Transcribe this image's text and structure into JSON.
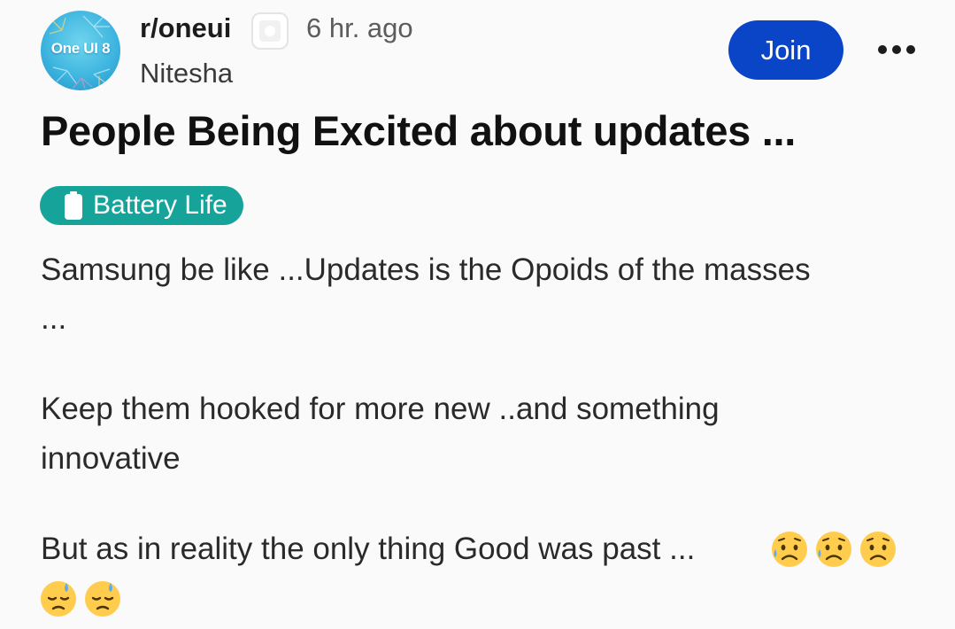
{
  "post": {
    "avatar": {
      "label": "One UI 8",
      "bg_color": "#3fb6e0"
    },
    "subreddit": "r/oneui",
    "badge_icon": "achievement-badge-icon",
    "timestamp": "6 hr. ago",
    "author": "Nitesha",
    "join_label": "Join",
    "more_icon": "more-options-icon",
    "title": "People Being Excited about updates ...",
    "flair": {
      "icon": "battery-icon",
      "label": "Battery Life",
      "color": "#16a39a"
    },
    "body": {
      "line1": "Samsung be like ...Updates is the Opoids of the masses",
      "line2": "...",
      "line3": "Keep them hooked for more new ..and something",
      "line4": "innovative",
      "line5": "But as in reality the only thing Good was past ..."
    },
    "emojis": [
      "sad-sweat-face",
      "sad-sweat-face",
      "sad-sweat-face",
      "downcast-sweat-face",
      "downcast-sweat-face"
    ],
    "accent_color": "#0a45c8"
  }
}
